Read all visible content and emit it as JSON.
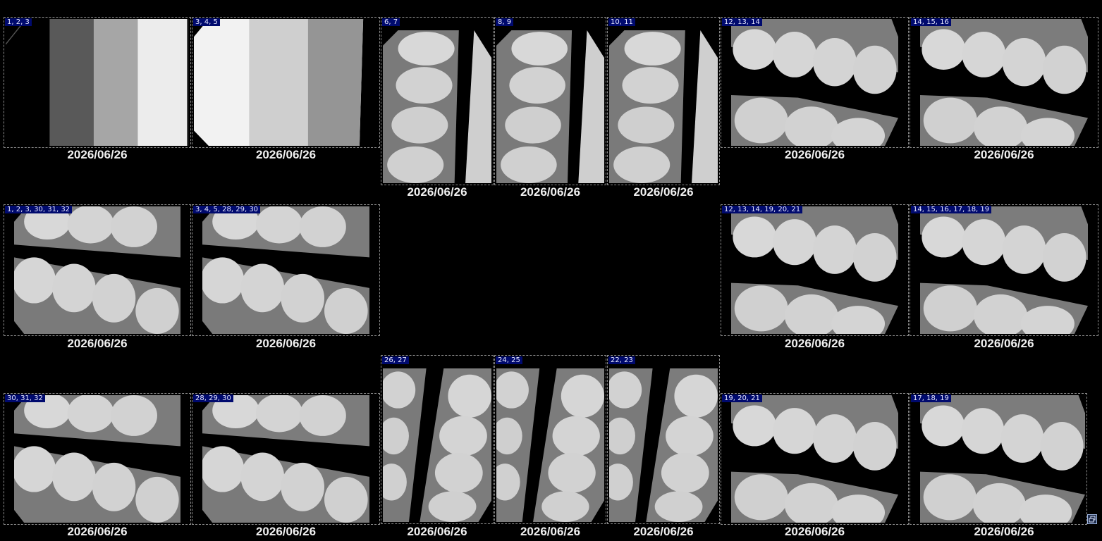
{
  "slots": [
    {
      "teeth": "1, 2, 3",
      "date": "2026/06/26",
      "image": "calibration-phantom"
    },
    {
      "teeth": "3, 4, 5",
      "date": "2026/06/26",
      "image": "calibration-phantom"
    },
    {
      "teeth": "6, 7",
      "date": "2026/06/26",
      "image": "vertical-periapical"
    },
    {
      "teeth": "8, 9",
      "date": "2026/06/26",
      "image": "vertical-periapical"
    },
    {
      "teeth": "10, 11",
      "date": "2026/06/26",
      "image": "vertical-periapical"
    },
    {
      "teeth": "12, 13, 14",
      "date": "2026/06/26",
      "image": "bitewing"
    },
    {
      "teeth": "14, 15, 16",
      "date": "2026/06/26",
      "image": "bitewing"
    },
    {
      "teeth": "1, 2, 3, 30, 31, 32",
      "date": "2026/06/26",
      "image": "bitewing"
    },
    {
      "teeth": "3, 4, 5, 28, 29, 30",
      "date": "2026/06/26",
      "image": "bitewing"
    },
    {
      "teeth": "12, 13, 14, 19, 20, 21",
      "date": "2026/06/26",
      "image": "bitewing"
    },
    {
      "teeth": "14, 15, 16, 17, 18, 19",
      "date": "2026/06/26",
      "image": "bitewing"
    },
    {
      "teeth": "30, 31, 32",
      "date": "2026/06/26",
      "image": "lower-periapical"
    },
    {
      "teeth": "28, 29, 30",
      "date": "2026/06/26",
      "image": "lower-periapical"
    },
    {
      "teeth": "26, 27",
      "date": "2026/06/26",
      "image": "vertical-periapical"
    },
    {
      "teeth": "24, 25",
      "date": "2026/06/26",
      "image": "vertical-periapical"
    },
    {
      "teeth": "22, 23",
      "date": "2026/06/26",
      "image": "vertical-periapical"
    },
    {
      "teeth": "19, 20, 21",
      "date": "2026/06/26",
      "image": "bitewing"
    },
    {
      "teeth": "17, 18, 19",
      "date": "2026/06/26",
      "image": "bitewing"
    }
  ],
  "corner_icon": "restore-windows-icon"
}
